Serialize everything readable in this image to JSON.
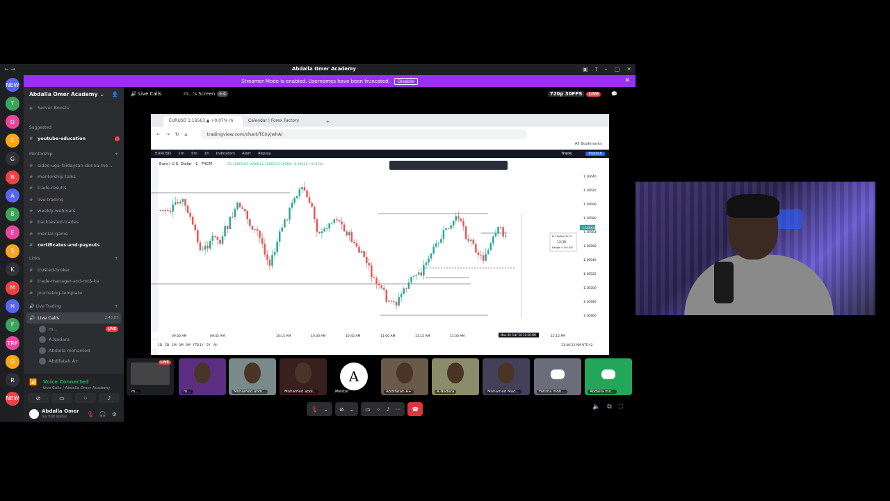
{
  "window": {
    "title": "Abdalla Omer Academy"
  },
  "banner": {
    "text": "Streamer Mode is enabled. Usernames have been truncated.",
    "button": "Disable"
  },
  "servers": [
    {
      "label": "NEW",
      "badge": ""
    },
    {
      "label": "T",
      "badge": "1"
    },
    {
      "label": "D",
      "badge": ""
    },
    {
      "label": "C",
      "badge": "4"
    },
    {
      "label": "G",
      "badge": ""
    },
    {
      "label": "N",
      "badge": ""
    },
    {
      "label": "A",
      "badge": ""
    },
    {
      "label": "B",
      "badge": "8"
    },
    {
      "label": "E",
      "badge": "27"
    },
    {
      "label": "S",
      "badge": "181"
    },
    {
      "label": "K",
      "badge": "863"
    },
    {
      "label": "M",
      "badge": "1"
    },
    {
      "label": "H",
      "badge": "290"
    },
    {
      "label": "F",
      "badge": "731"
    },
    {
      "label": "TRP",
      "badge": "51"
    },
    {
      "label": "Q",
      "badge": "723"
    },
    {
      "label": "R",
      "badge": "397"
    },
    {
      "label": "NEW",
      "badge": "514"
    }
  ],
  "sidebar": {
    "server_name": "Abdalla Omer Academy",
    "boosts": "Server Boosts",
    "suggested_label": "Suggested",
    "suggested_channel": "youtube-education",
    "mentorship_label": "Mentorship",
    "mentorship_channels": [
      "sidee-uga-faidaysan-donna-me...",
      "mentorship-talks",
      "trade-results",
      "live-trading",
      "weekly-webinars",
      "backtested-trades",
      "mental-game",
      "certificates-and-payouts"
    ],
    "links_label": "Links",
    "links_channels": [
      "trusted-broker",
      "trade-manager-and-mt5-ka",
      "journaling-template"
    ],
    "live_label": "Live Trading",
    "voice_channel": "Live Calls",
    "voice_time": "2:40:07",
    "voice_users": [
      {
        "name": "m...",
        "live": "LIVE"
      },
      {
        "name": "A.Nadara",
        "live": ""
      },
      {
        "name": "Abdalla mohamed",
        "live": ""
      },
      {
        "name": "Abdifatah A+",
        "live": ""
      }
    ]
  },
  "voice_panel": {
    "status": "Voice Connected",
    "location": "Live Calls / Abdalla Omer Academy"
  },
  "user_panel": {
    "name": "Abdalla Omer",
    "status": "my first status"
  },
  "main_header": {
    "channel": "Live Calls",
    "screen": "m...'s Screen",
    "extra": "+4",
    "quality": "720p 30FPS",
    "live": "LIVE"
  },
  "browser": {
    "tabs": [
      "EURUSD 1.16563 ▲ +0.07% m",
      "Calendar | Forex Factory"
    ],
    "url": "tradingview.com/chart/TCnyjwhA/",
    "bookmarks": "All Bookmarks"
  },
  "tradingview": {
    "symbol": "EURUSD",
    "timeframes": [
      "1m",
      "5m",
      "1h"
    ],
    "toolbar": [
      "Indicators",
      "Alert",
      "Replay"
    ],
    "trade": "Trade",
    "publish": "Publish",
    "legend": "Euro / U.S. Dollar · 1 · FXCM",
    "ohlc": "O1.16563 H1.16566 L1.16563 C1.16564 +0.00011 (+0.01%)",
    "price_labels": [
      "1.16640",
      "1.16620",
      "1.16600",
      "1.16580",
      "1.16564",
      "1.16560",
      "1.16540",
      "1.16522",
      "1.16500",
      "1.16480",
      "1.16460"
    ],
    "current_price": "1.16564",
    "time_labels": [
      "09:30 AM",
      "09:45 AM",
      "10:15 AM",
      "10:30 AM",
      "10:45 AM",
      "11:00 AM",
      "11:15 AM",
      "11:30 AM",
      "12:15 PM"
    ],
    "time_badge": "Mon 09 Feb '26  11:50 AM",
    "ranges": [
      "1D",
      "5D",
      "1M",
      "3M",
      "6M",
      "YTD",
      "1Y",
      "5Y",
      "All"
    ],
    "clock": "11:46:23 AM UTC+2",
    "candle_box": "M CANDLE PLCY",
    "candle_time": "13:38",
    "candle_range": "Range: 0.00 USD"
  },
  "participants": [
    {
      "name": "m...",
      "live": "LIVE"
    },
    {
      "name": "m...",
      "live": ""
    },
    {
      "name": "Mohamed ahm...",
      "live": ""
    },
    {
      "name": "Mohamed abdi...",
      "live": ""
    },
    {
      "name": "Mentor",
      "live": ""
    },
    {
      "name": "Abdifatah A+",
      "live": ""
    },
    {
      "name": "A.Nadara",
      "live": ""
    },
    {
      "name": "Mohamed Mad...",
      "live": ""
    },
    {
      "name": "Fatima moh...",
      "live": ""
    },
    {
      "name": "Abdalla mo...",
      "live": ""
    }
  ],
  "colors": {
    "bull": "#26a69a",
    "bear": "#ef5350",
    "accent": "#5865f2",
    "banner": "#9b2ffa"
  }
}
